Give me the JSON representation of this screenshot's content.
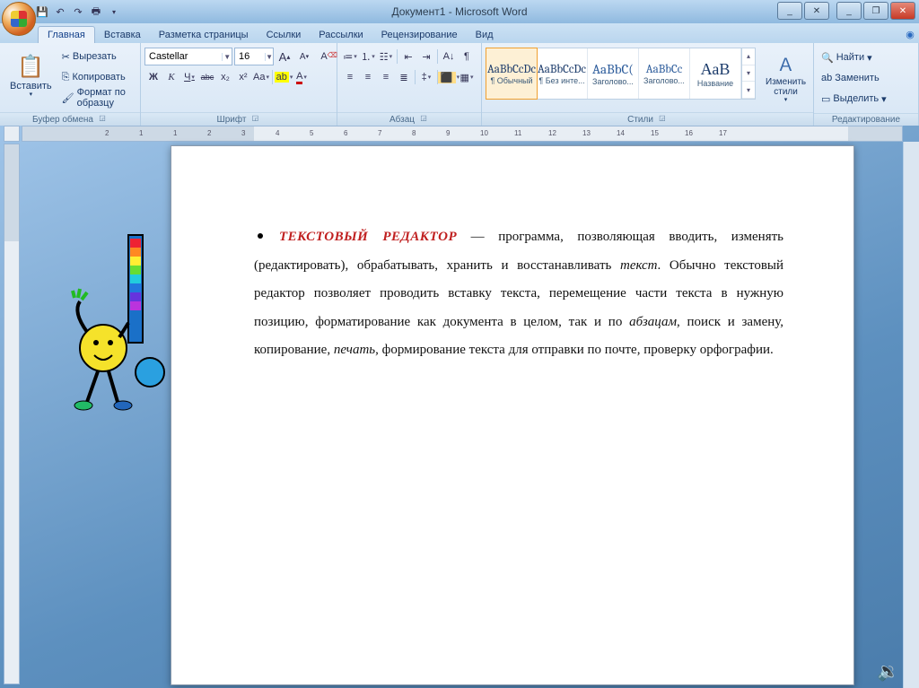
{
  "title": "Документ1 - Microsoft Word",
  "qat": {
    "save": "save",
    "undo": "undo",
    "redo": "redo",
    "print": "print"
  },
  "win": {
    "min": "_",
    "max": "❐",
    "close": "✕",
    "min2": "_",
    "close2": "✕"
  },
  "tabs": [
    "Главная",
    "Вставка",
    "Разметка страницы",
    "Ссылки",
    "Рассылки",
    "Рецензирование",
    "Вид"
  ],
  "activeTab": 0,
  "clipboard": {
    "paste": "Вставить",
    "cut": "Вырезать",
    "copy": "Копировать",
    "format_painter": "Формат по образцу",
    "group": "Буфер обмена"
  },
  "font": {
    "name": "Castellar",
    "size": "16",
    "grow": "A",
    "shrink": "A",
    "clear": "Aa",
    "bold": "Ж",
    "italic": "К",
    "underline": "Ч",
    "strike": "abc",
    "sub": "x₂",
    "sup": "x²",
    "case": "Aa",
    "hl_color": "#ffff00",
    "font_color": "#c00000",
    "group": "Шрифт"
  },
  "paragraph": {
    "group": "Абзац"
  },
  "styles": {
    "items": [
      {
        "prev": "AaBbCcDc",
        "name": "¶ Обычный",
        "sel": true
      },
      {
        "prev": "AaBbCcDc",
        "name": "¶ Без инте..."
      },
      {
        "prev": "AaBbC(",
        "name": "Заголово..."
      },
      {
        "prev": "AaBbCc",
        "name": "Заголово..."
      },
      {
        "prev": "АаВ",
        "name": "Название"
      }
    ],
    "change": "Изменить стили",
    "group": "Стили"
  },
  "editing": {
    "find": "Найти",
    "replace": "Заменить",
    "select": "Выделить",
    "group": "Редактирование"
  },
  "doc": {
    "heading": "ТЕКСТОВЫЙ РЕДАКТОР",
    "t1": " — программа, позволяющая вводить, изменять (редактировать), обрабатывать, хранить и восстанавливать ",
    "it1": "текст",
    "t2": ". Обычно текстовый редактор позволяет проводить вставку текста, перемещение части текста в нужную позицию, форматирование как документа в целом, так и по ",
    "it2": "абзацам",
    "t3": ", поиск и замену, копирование, ",
    "it3": "печать",
    "t4": ", формирование текста для отправки по почте, проверку орфографии."
  },
  "ruler_numbers": [
    "2",
    "1",
    "1",
    "2",
    "3",
    "4",
    "5",
    "6",
    "7",
    "8",
    "9",
    "10",
    "11",
    "12",
    "13",
    "14",
    "15",
    "16",
    "17"
  ]
}
